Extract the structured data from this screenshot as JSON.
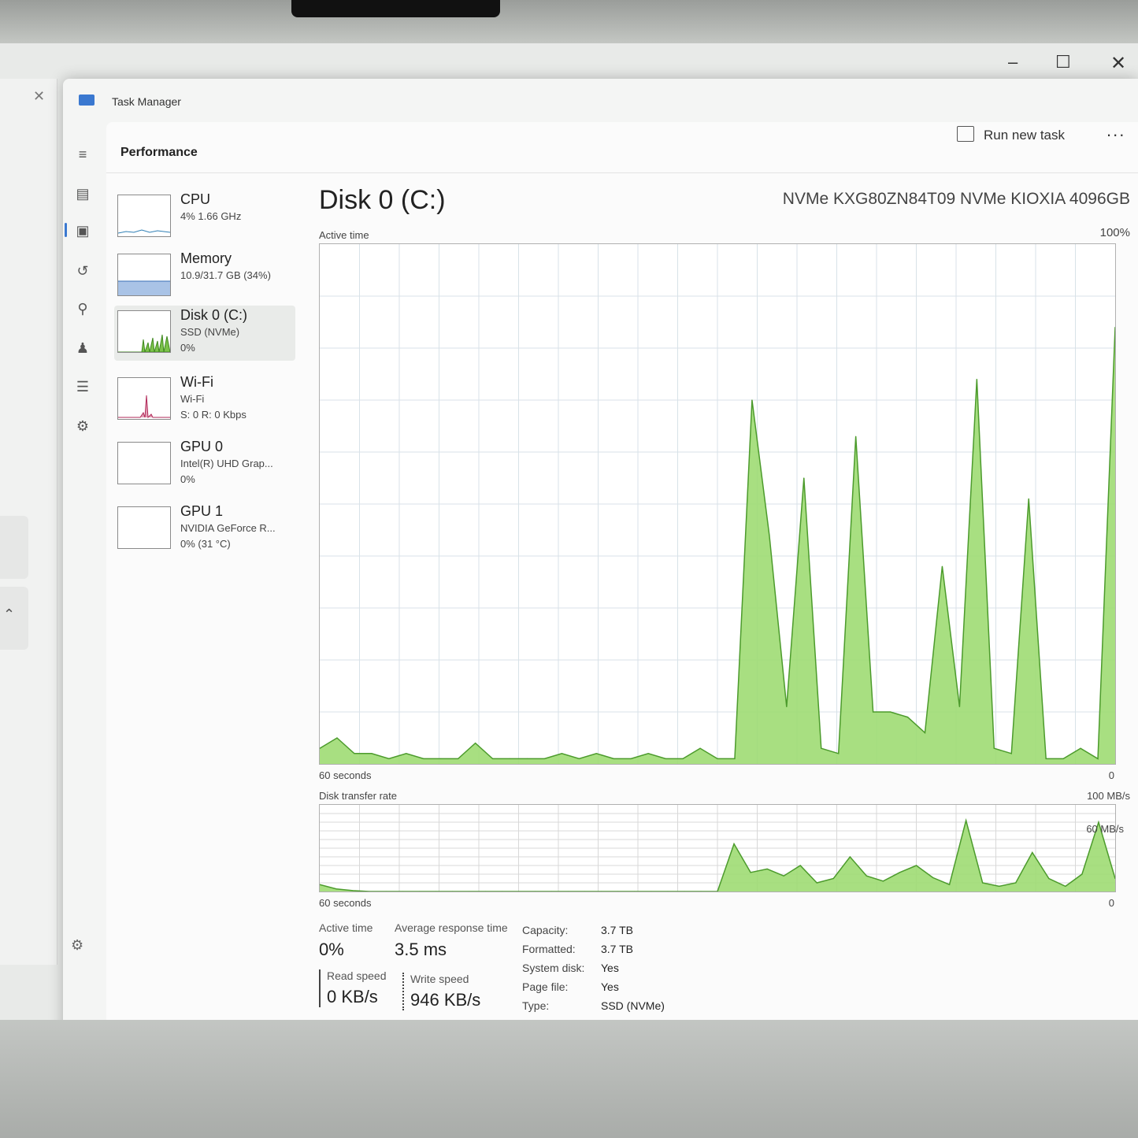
{
  "window": {
    "title": "Task Manager",
    "controls": {
      "minimize": "–",
      "maximize": "☐",
      "close": "✕"
    }
  },
  "toolbar": {
    "run_new_task": "Run new task",
    "more": "..."
  },
  "page": {
    "title": "Performance"
  },
  "nav_icons": [
    "menu-icon",
    "processes-icon",
    "performance-icon",
    "app-history-icon",
    "startup-apps-icon",
    "users-icon",
    "details-icon",
    "services-icon",
    "settings-icon"
  ],
  "devices": [
    {
      "name": "CPU",
      "sub": "4%  1.66 GHz",
      "sub2": ""
    },
    {
      "name": "Memory",
      "sub": "10.9/31.7 GB (34%)",
      "sub2": ""
    },
    {
      "name": "Disk 0 (C:)",
      "sub": "SSD (NVMe)",
      "sub2": "0%"
    },
    {
      "name": "Wi-Fi",
      "sub": "Wi-Fi",
      "sub2": "S: 0 R: 0 Kbps"
    },
    {
      "name": "GPU 0",
      "sub": "Intel(R) UHD Grap...",
      "sub2": "0%"
    },
    {
      "name": "GPU 1",
      "sub": "NVIDIA GeForce R...",
      "sub2": "0% (31 °C)"
    }
  ],
  "detail": {
    "title": "Disk 0 (C:)",
    "model": "NVMe KXG80ZN84T09 NVMe KIOXIA 4096GB",
    "active_time_label": "Active time",
    "active_time_max": "100%",
    "active_time_min": "0",
    "seconds_label": "60 seconds",
    "transfer_label": "Disk transfer rate",
    "transfer_max": "100 MB/s",
    "transfer_mid": "60 MB/s",
    "transfer_min": "0",
    "transfer_seconds_label": "60 seconds"
  },
  "stats": {
    "active_time": {
      "label": "Active time",
      "value": "0%"
    },
    "avg_response": {
      "label": "Average response time",
      "value": "3.5 ms"
    },
    "read_speed": {
      "label": "Read speed",
      "value": "0 KB/s"
    },
    "write_speed": {
      "label": "Write speed",
      "value": "946 KB/s"
    }
  },
  "properties": [
    {
      "key": "Capacity:",
      "value": "3.7 TB"
    },
    {
      "key": "Formatted:",
      "value": "3.7 TB"
    },
    {
      "key": "System disk:",
      "value": "Yes"
    },
    {
      "key": "Page file:",
      "value": "Yes"
    },
    {
      "key": "Type:",
      "value": "SSD (NVMe)"
    }
  ],
  "chart_data": [
    {
      "type": "area",
      "title": "Active time",
      "ylim": [
        0,
        100
      ],
      "x_range": [
        60,
        0
      ],
      "series": [
        {
          "values": [
            3,
            5,
            2,
            2,
            1,
            2,
            1,
            1,
            1,
            4,
            1,
            1,
            1,
            1,
            2,
            1,
            2,
            1,
            1,
            2,
            1,
            1,
            3,
            1,
            1,
            70,
            44,
            11,
            55,
            3,
            2,
            63,
            10,
            10,
            9,
            6,
            38,
            11,
            74,
            3,
            2,
            51,
            1,
            1,
            3,
            1,
            84
          ]
        }
      ],
      "colors": {
        "line": "#4c9b2c",
        "fill": "#9fdc73",
        "grid": "#d8e2e8"
      }
    },
    {
      "type": "area",
      "title": "Disk transfer rate",
      "ylim": [
        0,
        100
      ],
      "series": [
        {
          "name": "Write",
          "values": [
            8,
            3,
            1,
            0,
            0,
            0,
            0,
            0,
            0,
            0,
            0,
            0,
            0,
            0,
            0,
            0,
            0,
            0,
            0,
            0,
            0,
            0,
            0,
            0,
            0,
            55,
            22,
            26,
            18,
            30,
            10,
            15,
            40,
            18,
            12,
            22,
            30,
            16,
            8,
            82,
            10,
            6,
            10,
            45,
            15,
            6,
            20,
            80,
            15
          ]
        }
      ],
      "colors": {
        "line": "#4c9b2c",
        "fill": "#9fdc73"
      }
    }
  ]
}
